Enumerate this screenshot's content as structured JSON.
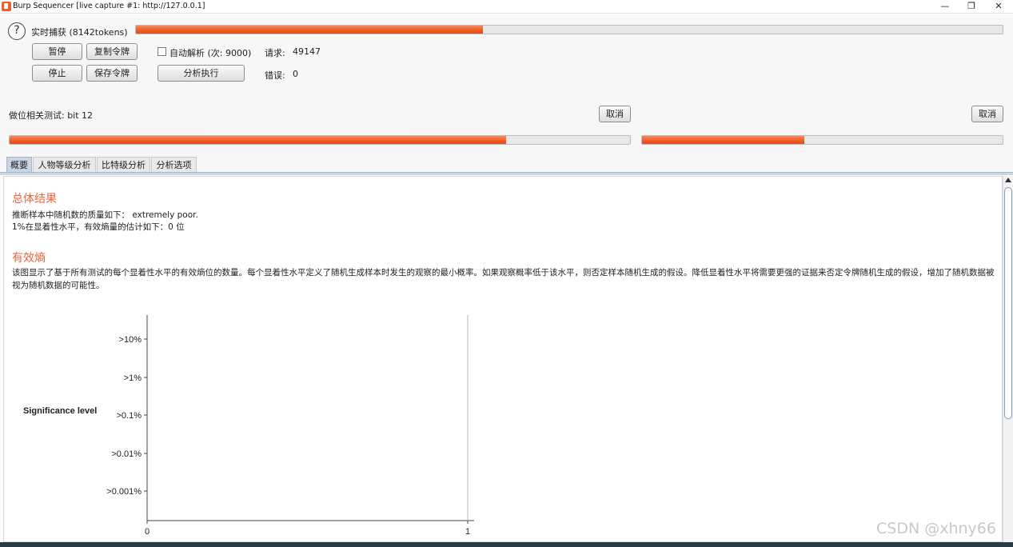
{
  "window": {
    "title": "Burp Sequencer [live capture #1: http://127.0.0.1]",
    "minimize_glyph": "—",
    "restore_glyph": "❐",
    "close_glyph": "✕"
  },
  "capture": {
    "help_glyph": "?",
    "status_label": "实时捕获 (8142tokens)",
    "progress_fraction": 0.4,
    "pause_label": "暂停",
    "copy_tokens_label": "复制令牌",
    "stop_label": "停止",
    "save_tokens_label": "保存令牌",
    "auto_analyze_label": "自动解析 (次: 9000)",
    "auto_analyze_checked": false,
    "analyze_now_label": "分析执行",
    "requests_label": "请求:",
    "requests_value": "49147",
    "errors_label": "错误:",
    "errors_value": "0"
  },
  "bit_test": {
    "status_label": "做位相关测试: bit 12",
    "cancel_left_label": "取消",
    "cancel_right_label": "取消",
    "progress_left_fraction": 0.8,
    "progress_right_fraction": 0.45
  },
  "tabs": [
    {
      "label": "概要",
      "active": true
    },
    {
      "label": "人物等级分析",
      "active": false
    },
    {
      "label": "比特级分析",
      "active": false
    },
    {
      "label": "分析选项",
      "active": false
    }
  ],
  "summary": {
    "overall_title": "总体结果",
    "overall_line1": "推断样本中随机数的质量如下： extremely poor.",
    "overall_line2": "1%在显着性水平，有效熵量的估计如下：0 位",
    "entropy_title": "有效熵",
    "entropy_text": "该图显示了基于所有测试的每个显着性水平的有效熵位的数量。每个显着性水平定义了随机生成样本时发生的观察的最小概率。如果观察概率低于该水平，则否定样本随机生成的假设。降低显着性水平将需要更强的证据来否定令牌随机生成的假设，增加了随机数据被视为随机数据的可能性。"
  },
  "chart_data": {
    "type": "bar",
    "categories": [
      ">10%",
      ">1%",
      ">0.1%",
      ">0.01%",
      ">0.001%"
    ],
    "values": [
      0,
      0,
      0,
      0,
      0
    ],
    "ylabel": "Significance level",
    "xlabel": "",
    "xlim": [
      0,
      1
    ],
    "x_ticks": [
      "0",
      "1"
    ],
    "orientation": "horizontal",
    "accent_color": "#e8663a"
  },
  "watermark": "CSDN @xhny66",
  "colors": {
    "progress": "#ee5a26",
    "section_title": "#e8663a",
    "active_tab": "#c8d6e5"
  }
}
